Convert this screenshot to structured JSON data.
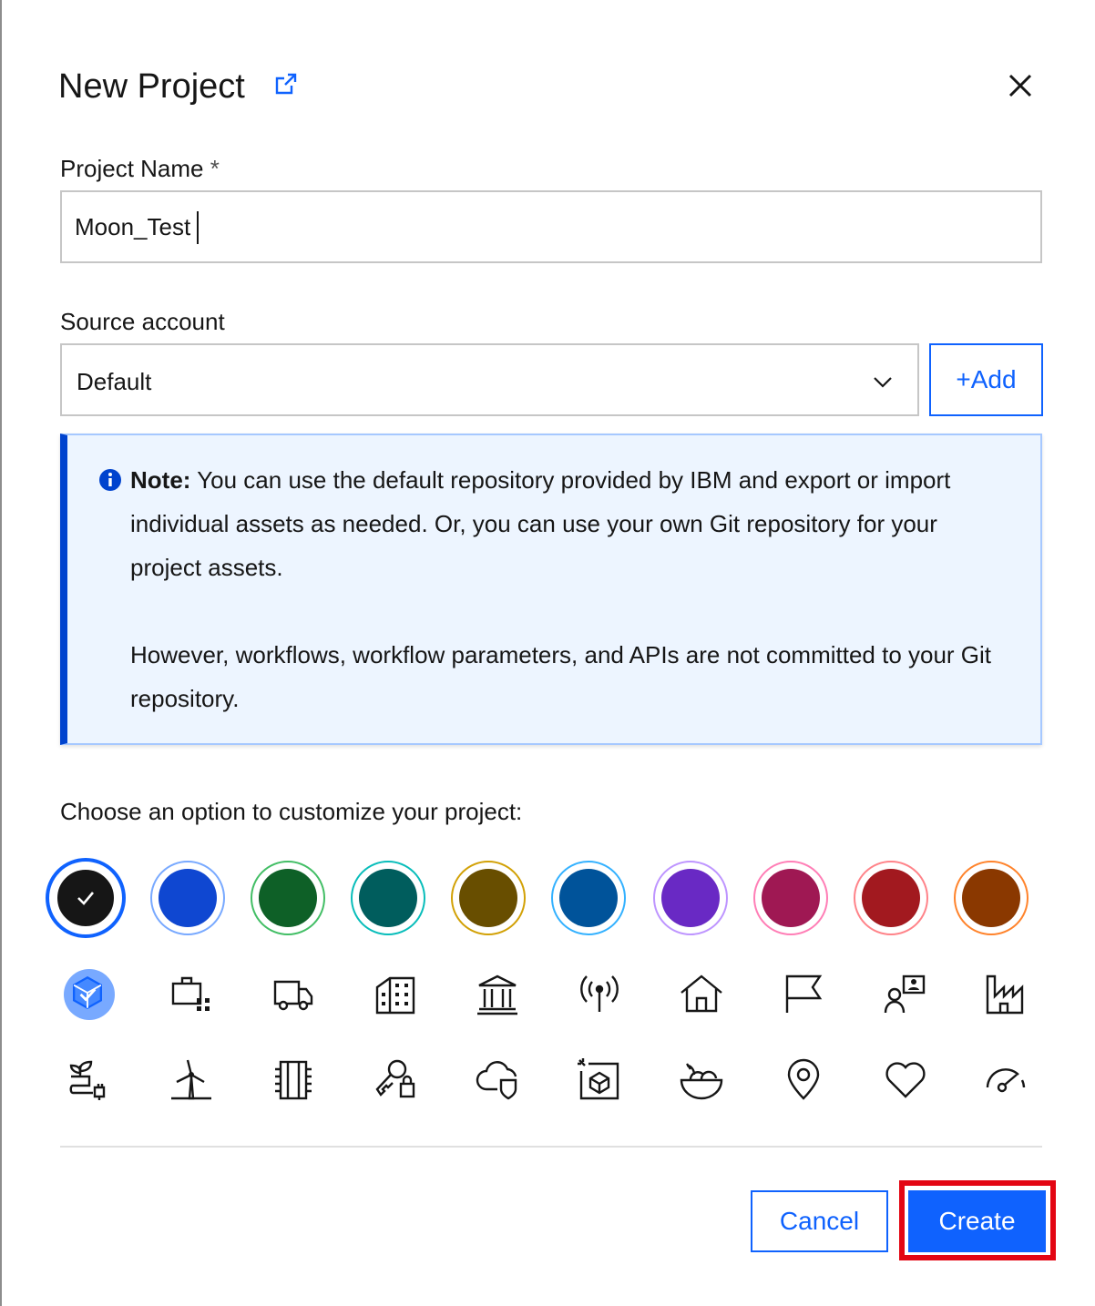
{
  "dialog": {
    "title": "New Project",
    "external_link_icon": "launch-icon",
    "close_icon": "close-icon"
  },
  "project_name": {
    "label": "Project Name",
    "required_mark": "*",
    "value": "Moon_Test"
  },
  "source_account": {
    "label": "Source account",
    "selected": "Default",
    "add_label": "+Add"
  },
  "note": {
    "prefix": "Note:",
    "text1": "You can use the default repository provided by IBM and export or import individual assets as needed. Or, you can use your own Git repository for your project assets.",
    "text2": "However, workflows, workflow parameters, and APIs are not committed to your Git repository."
  },
  "customize": {
    "label": "Choose an option to customize your project:",
    "colors": [
      {
        "name": "black",
        "fill": "#161616",
        "ring": "#0f62fe",
        "selected": true
      },
      {
        "name": "blue",
        "fill": "#0f47d1",
        "ring": "#78a9ff",
        "selected": false
      },
      {
        "name": "green",
        "fill": "#0e6027",
        "ring": "#42be65",
        "selected": false
      },
      {
        "name": "teal",
        "fill": "#005d5d",
        "ring": "#08bdba",
        "selected": false
      },
      {
        "name": "gold",
        "fill": "#684e00",
        "ring": "#d2a106",
        "selected": false
      },
      {
        "name": "cyan",
        "fill": "#00539a",
        "ring": "#33b1ff",
        "selected": false
      },
      {
        "name": "purple",
        "fill": "#6929c4",
        "ring": "#be95ff",
        "selected": false
      },
      {
        "name": "magenta",
        "fill": "#9f1853",
        "ring": "#ff7eb6",
        "selected": false
      },
      {
        "name": "red",
        "fill": "#a2191f",
        "ring": "#ff8389",
        "selected": false
      },
      {
        "name": "orange",
        "fill": "#8a3800",
        "ring": "#ff832b",
        "selected": false
      }
    ],
    "icons_row1": [
      "cube-icon",
      "building-network-icon",
      "delivery-truck-icon",
      "building-icon",
      "bank-icon",
      "antenna-icon",
      "home-icon",
      "flag-icon",
      "user-profile-icon",
      "factory-icon"
    ],
    "icons_row2": [
      "plant-power-icon",
      "wind-turbine-icon",
      "data-center-icon",
      "key-lock-icon",
      "cloud-security-icon",
      "package-icon",
      "fruit-bowl-icon",
      "location-icon",
      "heart-icon",
      "dashboard-gauge-icon"
    ]
  },
  "footer": {
    "cancel_label": "Cancel",
    "create_label": "Create"
  }
}
